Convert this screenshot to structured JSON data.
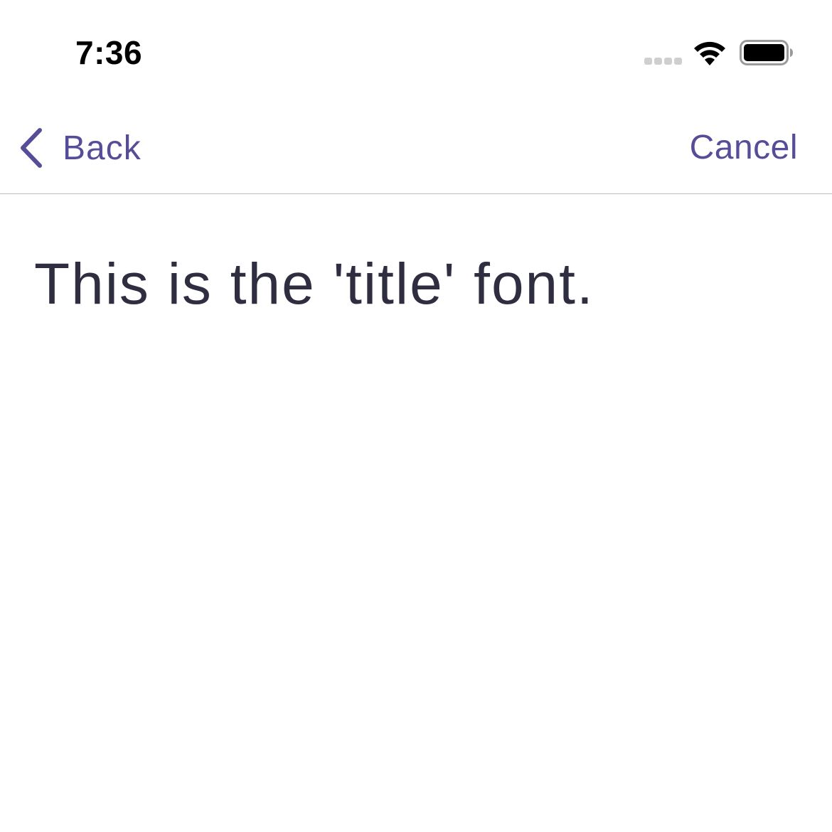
{
  "status_bar": {
    "time": "7:36",
    "signal_icon": "signal-bars-icon",
    "wifi_icon": "wifi-icon",
    "battery_icon": "battery-icon"
  },
  "nav": {
    "back_icon": "chevron-left-icon",
    "back_label": "Back",
    "cancel_label": "Cancel"
  },
  "content": {
    "title_text": "This is the 'title' font."
  },
  "colors": {
    "accent": "#564d98",
    "text": "#2f2e41",
    "divider": "#bdbdbd",
    "background": "#ffffff"
  }
}
